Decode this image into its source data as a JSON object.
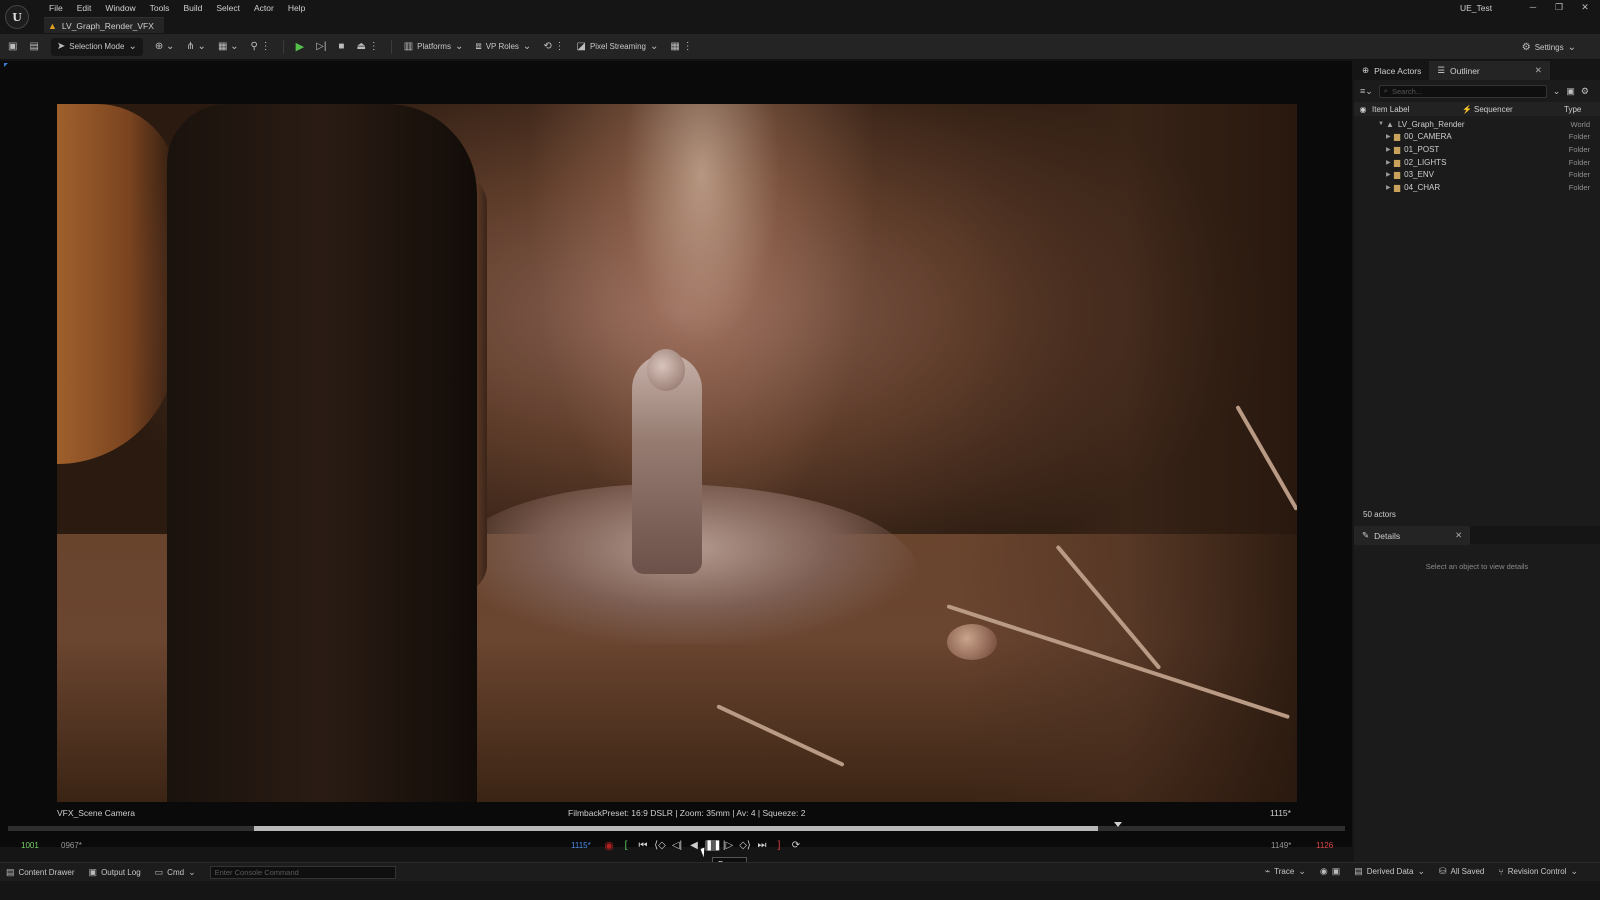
{
  "menu": [
    "File",
    "Edit",
    "Window",
    "Tools",
    "Build",
    "Select",
    "Actor",
    "Help"
  ],
  "level_tab": "LV_Graph_Render_VFX",
  "project_name": "UE_Test",
  "toolbar": {
    "selection_mode": "Selection Mode",
    "platforms": "Platforms",
    "vp_roles": "VP Roles",
    "pixel_streaming": "Pixel Streaming",
    "settings": "Settings"
  },
  "viewport": {
    "camera_label": "VFX_Scene Camera",
    "filmback": "FilmbackPreset: 16:9 DSLR | Zoom: 35mm | Av: 4 | Squeeze: 2",
    "frame_right": "1115*"
  },
  "timeline": {
    "start": "1001",
    "start2": "0967*",
    "current": "1115*",
    "end2": "1149*",
    "end": "1126",
    "playhead_fraction": 0.83,
    "range_start_fraction": 0.184,
    "range_end_fraction": 0.815
  },
  "tooltip": "Pause",
  "statusbar": {
    "content_drawer": "Content Drawer",
    "output_log": "Output Log",
    "cmd": "Cmd",
    "console_placeholder": "Enter Console Command",
    "trace": "Trace",
    "derived_data": "Derived Data",
    "all_saved": "All Saved",
    "revision_control": "Revision Control"
  },
  "outliner": {
    "tab_place_actors": "Place Actors",
    "tab_outliner": "Outliner",
    "search_placeholder": "Search...",
    "col_label": "Item Label",
    "col_sequencer": "Sequencer",
    "col_type": "Type",
    "root": {
      "label": "LV_Graph_Render",
      "type": "World"
    },
    "items": [
      {
        "label": "00_CAMERA",
        "type": "Folder"
      },
      {
        "label": "01_POST",
        "type": "Folder"
      },
      {
        "label": "02_LIGHTS",
        "type": "Folder"
      },
      {
        "label": "03_ENV",
        "type": "Folder"
      },
      {
        "label": "04_CHAR",
        "type": "Folder"
      }
    ],
    "actor_count": "50 actors"
  },
  "details": {
    "tab": "Details",
    "hint": "Select an object to view details"
  }
}
